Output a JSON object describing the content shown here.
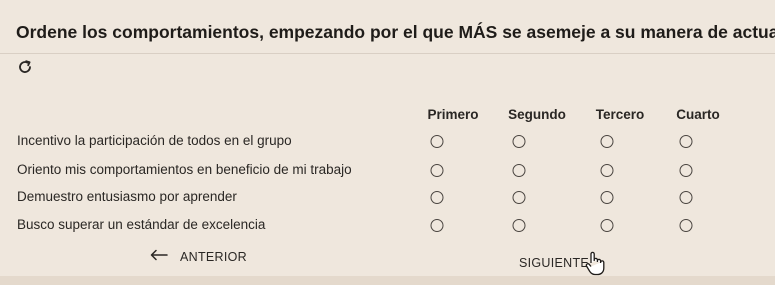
{
  "question": {
    "text": "Ordene los comportamientos, empezando por el que MÁS se asemeje a su manera de actuar."
  },
  "reset": {
    "icon": "reload-icon"
  },
  "columns": [
    "Primero",
    "Segundo",
    "Tercero",
    "Cuarto"
  ],
  "rows": [
    {
      "label": "Incentivo la participación de todos en el grupo"
    },
    {
      "label": "Oriento mis comportamientos en beneficio de mi trabajo"
    },
    {
      "label": "Demuestro entusiasmo por aprender"
    },
    {
      "label": "Busco superar un estándar de excelencia"
    }
  ],
  "navigation": {
    "prev_label": "ANTERIOR",
    "prev_icon": "arrow-left-icon",
    "next_label": "SIGUIENTE"
  },
  "colors": {
    "background": "#efe7dd",
    "text": "#2a2724"
  }
}
